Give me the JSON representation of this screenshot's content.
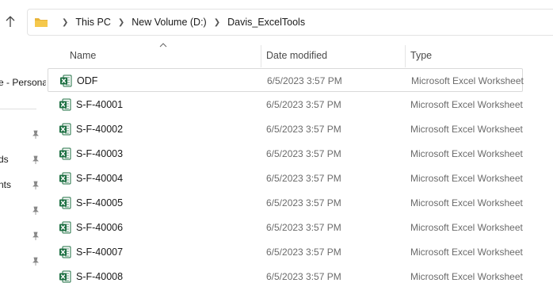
{
  "address_bar": {
    "breadcrumbs": [
      "This PC",
      "New Volume (D:)",
      "Davis_ExcelTools"
    ]
  },
  "sidebar": {
    "items": [
      {
        "label": "e - Persona",
        "pinned": false
      },
      {
        "label": "",
        "pinned": true
      },
      {
        "label": "ds",
        "pinned": true
      },
      {
        "label": "nts",
        "pinned": true
      },
      {
        "label": "",
        "pinned": true
      },
      {
        "label": "",
        "pinned": true
      },
      {
        "label": "",
        "pinned": true
      }
    ]
  },
  "columns": {
    "name": "Name",
    "date_modified": "Date modified",
    "type": "Type",
    "sorted_by": "name"
  },
  "files": [
    {
      "name": "ODF",
      "date": "6/5/2023 3:57 PM",
      "type": "Microsoft Excel Worksheet",
      "selected": true
    },
    {
      "name": "S-F-40001",
      "date": "6/5/2023 3:57 PM",
      "type": "Microsoft Excel Worksheet"
    },
    {
      "name": "S-F-40002",
      "date": "6/5/2023 3:57 PM",
      "type": "Microsoft Excel Worksheet"
    },
    {
      "name": "S-F-40003",
      "date": "6/5/2023 3:57 PM",
      "type": "Microsoft Excel Worksheet"
    },
    {
      "name": "S-F-40004",
      "date": "6/5/2023 3:57 PM",
      "type": "Microsoft Excel Worksheet"
    },
    {
      "name": "S-F-40005",
      "date": "6/5/2023 3:57 PM",
      "type": "Microsoft Excel Worksheet"
    },
    {
      "name": "S-F-40006",
      "date": "6/5/2023 3:57 PM",
      "type": "Microsoft Excel Worksheet"
    },
    {
      "name": "S-F-40007",
      "date": "6/5/2023 3:57 PM",
      "type": "Microsoft Excel Worksheet"
    },
    {
      "name": "S-F-40008",
      "date": "6/5/2023 3:57 PM",
      "type": "Microsoft Excel Worksheet"
    }
  ],
  "colors": {
    "folder": "#E8B43A",
    "excel_green": "#1D6F42",
    "selection_border": "#d9d9d9"
  },
  "icons": {
    "up": "arrow-up-icon",
    "folder": "folder-icon",
    "pin": "pin-icon",
    "file": "excel-file-icon"
  }
}
